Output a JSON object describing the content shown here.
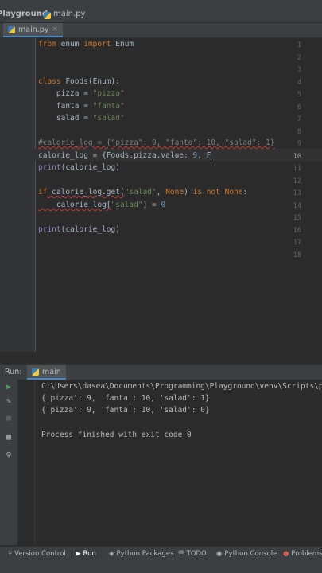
{
  "navbar": {
    "project": "Playground",
    "file": "main.py"
  },
  "tabs": [
    {
      "label": "main.py",
      "close": "×"
    }
  ],
  "editor": {
    "line_numbers": [
      "1",
      "2",
      "3",
      "4",
      "5",
      "6",
      "7",
      "8",
      "9",
      "10",
      "11",
      "12",
      "13",
      "14",
      "15",
      "16",
      "17",
      "18"
    ],
    "current_line": "10",
    "lines": {
      "l1": {
        "kw": "from",
        "mod": " enum ",
        "kw2": "import",
        "name": " Enum"
      },
      "l4": {
        "kw": "class",
        "rest": " Foods(Enum):"
      },
      "l5": {
        "name": "    pizza = ",
        "str": "\"pizza\""
      },
      "l6": {
        "name": "    fanta = ",
        "str": "\"fanta\""
      },
      "l7": {
        "name": "    salad = ",
        "str": "\"salad\""
      },
      "l9": {
        "comment": "#calorie_log = {\"pizza\": 9, \"fanta\": 10, \"salad\": 1}"
      },
      "l10": {
        "a": "calorie_log = {Foods.pizza.value: ",
        "num": "9",
        "b": ", F"
      },
      "l11": {
        "fn": "print",
        "rest": "(calorie_log)"
      },
      "l13": {
        "kw": "if",
        "a": " calorie_log.get(",
        "str": "\"salad\"",
        "b": ", ",
        "kw2": "None",
        "c": ") ",
        "kw3": "is not",
        "d": " ",
        "kw4": "None",
        "e": ":"
      },
      "l14": {
        "a": "    calorie_log[",
        "str": "\"salad\"",
        "b": "] = ",
        "num": "0"
      },
      "l16": {
        "fn": "print",
        "rest": "(calorie_log)"
      }
    }
  },
  "run": {
    "label": "Run:",
    "tab": "main",
    "output": [
      "C:\\Users\\dasea\\Documents\\Programming\\Playground\\venv\\Scripts\\py",
      "{'pizza': 9, 'fanta': 10, 'salad': 1}",
      "{'pizza': 9, 'fanta': 10, 'salad': 0}",
      "",
      "Process finished with exit code 0"
    ]
  },
  "statusbar": {
    "items": [
      {
        "label": "Version Control",
        "icon": "branch-icon"
      },
      {
        "label": "Run",
        "icon": "play-icon"
      },
      {
        "label": "Python Packages",
        "icon": "packages-icon"
      },
      {
        "label": "TODO",
        "icon": "list-icon"
      },
      {
        "label": "Python Console",
        "icon": "console-icon"
      },
      {
        "label": "Problems",
        "icon": "problems-icon"
      }
    ]
  },
  "colors": {
    "run_green": "#499c54",
    "accent_blue": "#4a88c7",
    "error_red": "#db5c5c"
  }
}
